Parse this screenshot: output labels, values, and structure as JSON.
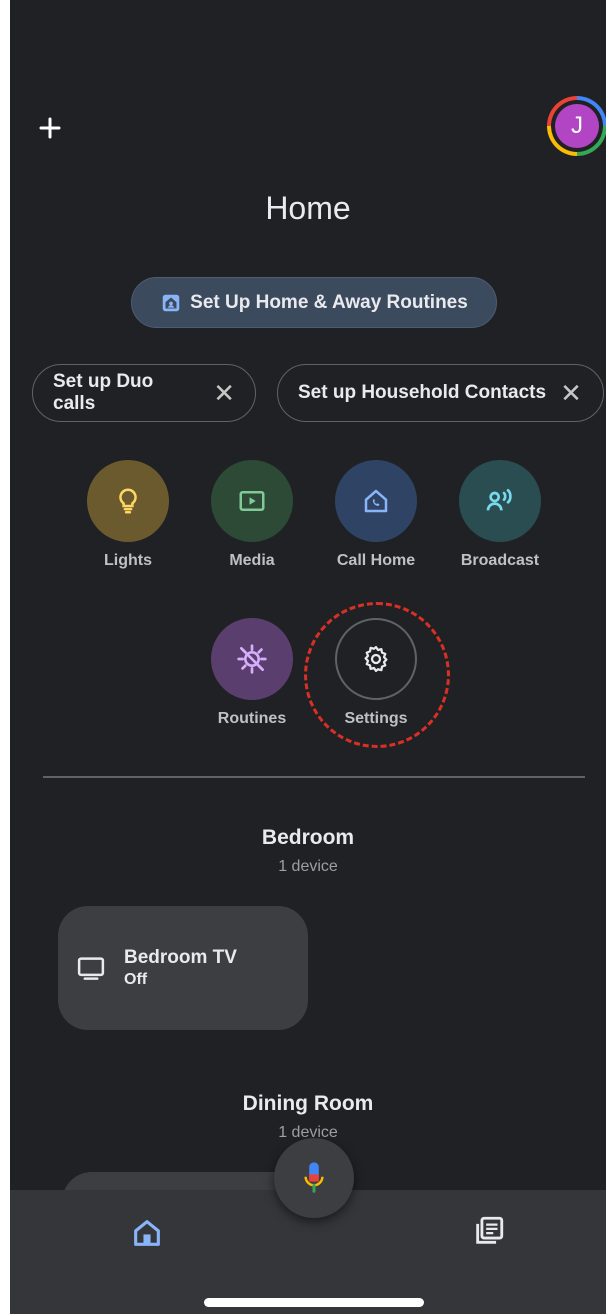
{
  "header": {
    "title": "Home",
    "avatar_initial": "J",
    "icons": {
      "add": "plus-icon"
    }
  },
  "setup": {
    "primary_label": "Set Up Home & Away Routines",
    "chips": [
      {
        "label": "Set up Duo calls"
      },
      {
        "label": "Set up Household Contacts"
      }
    ],
    "dismiss_glyph": "✕"
  },
  "actions": [
    {
      "label": "Lights",
      "icon": "lightbulb-icon",
      "bg": "#6b5a2e",
      "fg": "#fdd663"
    },
    {
      "label": "Media",
      "icon": "media-icon",
      "bg": "#2c4a36",
      "fg": "#81c995"
    },
    {
      "label": "Call Home",
      "icon": "call-home-icon",
      "bg": "#2f4465",
      "fg": "#8ab4f8"
    },
    {
      "label": "Broadcast",
      "icon": "broadcast-icon",
      "bg": "#2a4d52",
      "fg": "#78d9ec"
    },
    {
      "label": "Routines",
      "icon": "routines-icon",
      "bg": "#5a3f6e",
      "fg": "#d7aefb"
    },
    {
      "label": "Settings",
      "icon": "settings-icon",
      "bg": "#202124",
      "fg": "#e8eaed"
    }
  ],
  "rooms": [
    {
      "name": "Bedroom",
      "count": "1 device",
      "devices": [
        {
          "name": "Bedroom TV",
          "status": "Off"
        }
      ]
    },
    {
      "name": "Dining Room",
      "count": "1 device"
    }
  ],
  "nav": {
    "icons": [
      "home-icon",
      "feed-icon"
    ]
  },
  "colors": {
    "background": "#202124",
    "surface": "#3c3e42",
    "accent_blue": "#8ab4f8",
    "highlight_red": "#d93025"
  }
}
